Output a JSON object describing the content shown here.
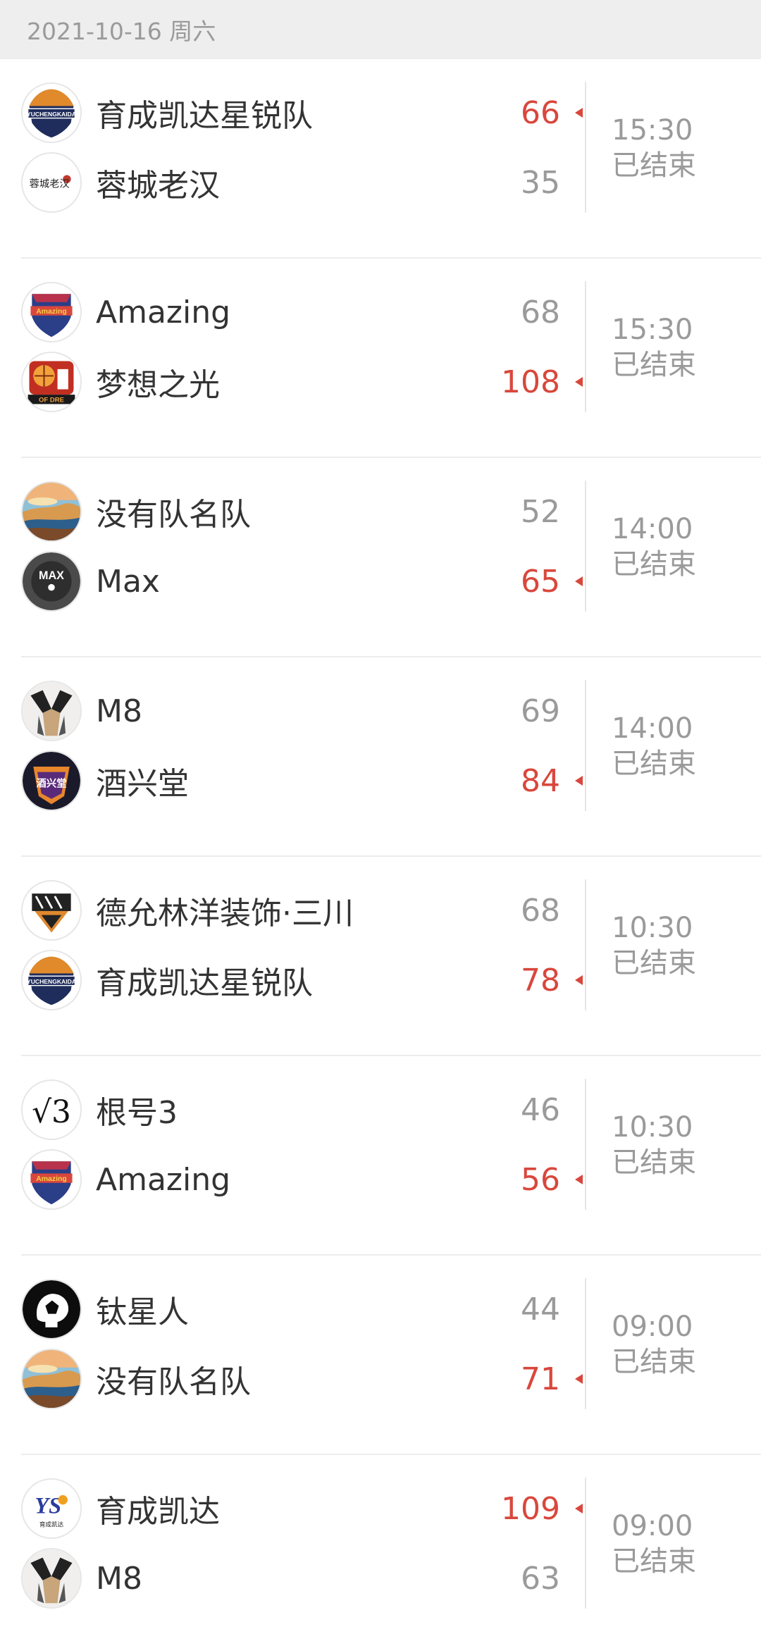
{
  "date_header": "2021-10-16 周六",
  "matches": [
    {
      "home": {
        "name": "育成凯达星锐队",
        "score": "66",
        "win": true,
        "logo": "yuchengkaida-shield-logo"
      },
      "away": {
        "name": "蓉城老汉",
        "score": "35",
        "win": false,
        "logo": "rongcheng-laohan-logo"
      },
      "time": "15:30",
      "status": "已结束"
    },
    {
      "home": {
        "name": "Amazing",
        "score": "68",
        "win": false,
        "logo": "amazing-shield-logo"
      },
      "away": {
        "name": "梦想之光",
        "score": "108",
        "win": true,
        "logo": "dream-light-basketball-logo"
      },
      "time": "15:30",
      "status": "已结束"
    },
    {
      "home": {
        "name": "没有队名队",
        "score": "52",
        "win": false,
        "logo": "landscape-logo"
      },
      "away": {
        "name": "Max",
        "score": "65",
        "win": true,
        "logo": "max-dark-logo"
      },
      "time": "14:00",
      "status": "已结束"
    },
    {
      "home": {
        "name": "M8",
        "score": "69",
        "win": false,
        "logo": "m8-logo"
      },
      "away": {
        "name": "酒兴堂",
        "score": "84",
        "win": true,
        "logo": "jiuxingtang-logo"
      },
      "time": "14:00",
      "status": "已结束"
    },
    {
      "home": {
        "name": "德允林洋装饰·三川",
        "score": "68",
        "win": false,
        "logo": "sanchuan-logo"
      },
      "away": {
        "name": "育成凯达星锐队",
        "score": "78",
        "win": true,
        "logo": "yuchengkaida-shield-logo"
      },
      "time": "10:30",
      "status": "已结束"
    },
    {
      "home": {
        "name": "根号3",
        "score": "46",
        "win": false,
        "logo": "sqrt3-logo"
      },
      "away": {
        "name": "Amazing",
        "score": "56",
        "win": true,
        "logo": "amazing-shield-logo"
      },
      "time": "10:30",
      "status": "已结束"
    },
    {
      "home": {
        "name": "钛星人",
        "score": "44",
        "win": false,
        "logo": "taixingren-logo"
      },
      "away": {
        "name": "没有队名队",
        "score": "71",
        "win": true,
        "logo": "landscape-logo"
      },
      "time": "09:00",
      "status": "已结束"
    },
    {
      "home": {
        "name": "育成凯达",
        "score": "109",
        "win": true,
        "logo": "yuchengkaida-ys-logo"
      },
      "away": {
        "name": "M8",
        "score": "63",
        "win": false,
        "logo": "m8-logo"
      },
      "time": "09:00",
      "status": "已结束"
    }
  ],
  "logo_text": {
    "yuchengkaida-shield-logo": "YUCHENGKAIDA",
    "rongcheng-laohan-logo": "蓉城老汉",
    "amazing-shield-logo": "Amazing",
    "dream-light-basketball-logo": "OF DRE",
    "max-dark-logo": "MAX",
    "jiuxingtang-logo": "酒兴堂",
    "sqrt3-logo": "√3",
    "yuchengkaida-ys-logo": "育成凯达"
  },
  "colors": {
    "win": "#d9473c",
    "muted": "#9a9a9a",
    "team_text": "#333333",
    "date_bar_bg": "#eeeeee"
  }
}
